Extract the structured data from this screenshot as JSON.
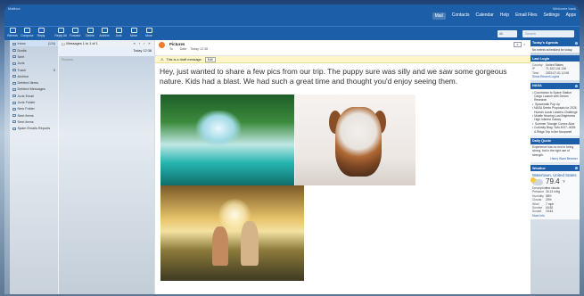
{
  "app": {
    "brand": "Mailbox",
    "user": "Welcome back"
  },
  "topnav": [
    {
      "label": "Mail",
      "name": "topnav-mail",
      "active": true
    },
    {
      "label": "Contacts",
      "name": "topnav-contacts"
    },
    {
      "label": "Calendar",
      "name": "topnav-calendar"
    },
    {
      "label": "Help",
      "name": "topnav-help"
    },
    {
      "label": "Email Files",
      "name": "topnav-email-files"
    },
    {
      "label": "Settings",
      "name": "topnav-settings"
    },
    {
      "label": "Apps",
      "name": "topnav-apps"
    }
  ],
  "toolbar": {
    "buttons": [
      "Refresh",
      "Compose",
      "Reply",
      "Reply All",
      "Forward",
      "Delete",
      "Archive",
      "Junk",
      "Move",
      "More"
    ],
    "dropdown": "All",
    "search_placeholder": "Search"
  },
  "folders": [
    {
      "label": "Inbox",
      "count": "(124)",
      "selected": true
    },
    {
      "label": "Drafts",
      "count": ""
    },
    {
      "label": "Sent",
      "count": ""
    },
    {
      "label": "Junk",
      "count": ""
    },
    {
      "label": "Trash",
      "count": "5"
    },
    {
      "label": "Archive",
      "count": ""
    },
    {
      "label": "Deleted Items",
      "count": ""
    },
    {
      "label": "Deleted Messages",
      "count": ""
    },
    {
      "label": "Junk Email",
      "count": ""
    },
    {
      "label": "Junk Folder",
      "count": ""
    },
    {
      "label": "New Folder",
      "count": ""
    },
    {
      "label": "Sent Items",
      "count": ""
    },
    {
      "label": "Sent Items",
      "count": ""
    },
    {
      "label": "Spam Emails Reports",
      "count": ""
    }
  ],
  "msglist": {
    "header": "Messages 1 to 1 of 1",
    "nav": "« ‹ › »",
    "item_subject": "",
    "item_date": "Today 12:38",
    "item2": "Pictures"
  },
  "reader": {
    "subject": "Pictures",
    "from_label": "To",
    "from": "",
    "date_label": "Date",
    "date": "Today 12:38",
    "draft_notice": "This is a draft message.",
    "draft_edit": "Edit",
    "body": "Hey, just wanted to share a few pics from our trip. The puppy sure was silly and we saw some gorgeous nature. Kids had a blast. We had such a great time and thought you'd enjoy seeing them."
  },
  "right": {
    "agenda_title": "Today's Agenda",
    "agenda_text": "No events scheduled for today.",
    "login_title": "Last Login",
    "login": [
      {
        "k": "Country",
        "v": "United States"
      },
      {
        "k": "IP",
        "v": "71.102.141.136"
      },
      {
        "k": "Time",
        "v": "2023-07-01 12:08"
      }
    ],
    "login_link": "Show Recent Logins",
    "news_title": "NASA",
    "news": [
      "Countdown to Space Station Cargo Launch with Dream Research",
      "Spacewalk Pop Up",
      "NASA Seeks Proposals for 2026 Human Lunar Landers Challenge",
      "Mobile Hearing Lost Brightness High Interest Galaxy",
      "Summer Triangle Comes Alive",
      "Curiosity Blog: Sols 4027–4028: A Ridge Trip in the Nonpareil"
    ],
    "quote_title": "Daily Quote",
    "quote": "Experience has no end in being strong, but in the right use of strength.",
    "quote_author": "Henry Ward Beecher",
    "weather_title": "Weather",
    "weather_location": "Watertown, United States",
    "weather_temp": "79.4",
    "weather_unit": "°F",
    "weather_rows": [
      {
        "k": "Description",
        "v": "few clouds"
      },
      {
        "k": "Pressure",
        "v": "30.13 inHg"
      },
      {
        "k": "Humidity",
        "v": "58%"
      },
      {
        "k": "Clouds",
        "v": "20%"
      },
      {
        "k": "Wind",
        "v": "7 mph"
      },
      {
        "k": "Sunrise",
        "v": "04:52"
      },
      {
        "k": "Sunset",
        "v": "19:44"
      }
    ],
    "weather_link": "More Info"
  }
}
